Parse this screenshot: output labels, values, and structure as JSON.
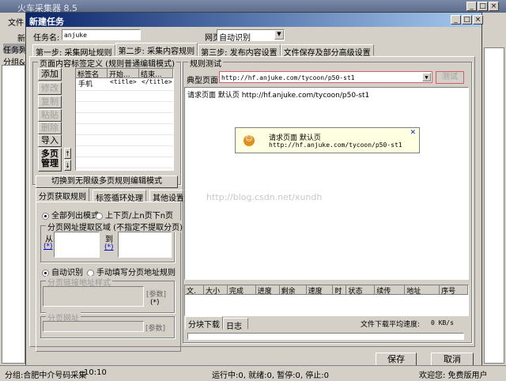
{
  "app": {
    "title": "火车采集器 8.5",
    "menu_file": "文件",
    "toolbar_new": "新",
    "panel_task_list": "任务列",
    "panel_group": "分组&任"
  },
  "dialog": {
    "title": "新建任务",
    "task_name_label": "任务名:",
    "task_name_value": "anjuke",
    "encoding_label": "网页编码:",
    "encoding_value": "自动识别",
    "tabs": [
      "第一步: 采集网址规则",
      "第二步: 采集内容规则",
      "第三步: 发布内容设置",
      "文件保存及部分高级设置"
    ],
    "save": "保存",
    "cancel": "取消"
  },
  "left": {
    "group_title": "页面内容标签定义 (规则普通编辑模式)",
    "buttons": [
      "添加",
      "修改",
      "复制",
      "粘贴",
      "删除",
      "导入",
      "多页管理"
    ],
    "table_headers": [
      "标签名",
      "开始...",
      "结束..."
    ],
    "rows": [
      [
        "手机",
        "<title>",
        "</title>"
      ]
    ],
    "switch_button": "切换到无限级多页规则编辑模式",
    "subtabs": [
      "分页获取规则",
      "标签循环处理",
      "其他设置"
    ],
    "radio_all": "全部列出模式",
    "radio_prevnext": "上下页/上n页下n页",
    "region_title": "分页网址提取区域 (不指定不提取分页)",
    "from": "从",
    "to": "到",
    "star_link": "(*)",
    "radio_auto": "自动识别",
    "radio_manual": "手动填写分页地址规则",
    "pattern_title": "分页链接地址样式",
    "param": "[参数]",
    "star": "(*)",
    "url_title": "分页网址",
    "param2": "[参数]"
  },
  "right": {
    "group_title": "规则测试",
    "page_label": "典型页面:",
    "page_url": "http://hf.anjuke.com/tycoon/p50-st1",
    "test_button": "测试",
    "result_text": "请求页面 默认页 http://hf.anjuke.com/tycoon/p50-st1",
    "popup_line1": "请求页面 默认页",
    "popup_line2": "http://hf.anjuke.com/tycoon/p50-st1",
    "watermark": "http://blog.csdn.net/xundh",
    "download_headers": [
      "文.",
      "大小",
      "完成",
      "进度",
      "剩余",
      "速度",
      "时",
      "状态",
      "续传",
      "地址",
      "序号"
    ],
    "bottom_tabs": [
      "分块下载",
      "日志"
    ],
    "speed_label": "文件下载平均速度:",
    "speed_value": "0 KB/s"
  },
  "status": {
    "group": "分组:合肥中介号码采集",
    "time": "10:10",
    "counts": "运行中:0, 就绪:0, 暂停:0, 停止:0",
    "welcome": "欢迎您: 免费版用户"
  }
}
